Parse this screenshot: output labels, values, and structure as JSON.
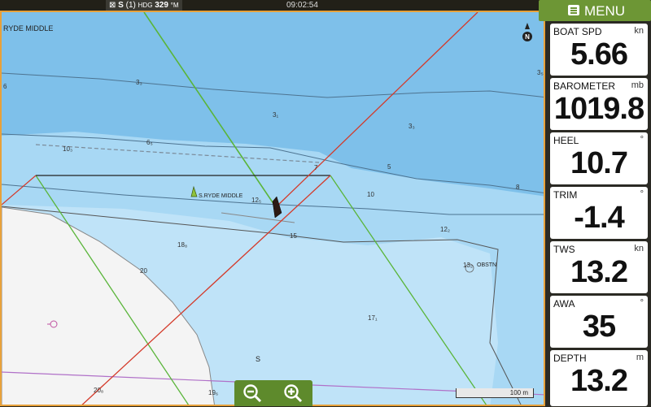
{
  "status": {
    "sat": "S",
    "sat_count": "(1)",
    "hdg_label": "HDG",
    "hdg_value": "329",
    "hdg_unit": "°M",
    "time": "09:02:54"
  },
  "menu": {
    "label": "MENU"
  },
  "chart": {
    "location_label": "RYDE MIDDLE",
    "buoy_label": "S.RYDE MIDDLE",
    "obstn_label": "OBSTN",
    "north_label": "N",
    "scale_label": "100 m",
    "seabed_label": "S",
    "depths": {
      "d1": "3₃",
      "d2": "3₁",
      "d3": "3₃",
      "d4": "6₅",
      "d5": "10₃",
      "d6": "7",
      "d7": "5",
      "d8": "10",
      "d9": "8",
      "d10": "12₅",
      "d11": "15",
      "d12": "12₂",
      "d13": "18₈",
      "d14": "13₂",
      "d15": "20",
      "d16": "17₁",
      "d17": "20₈",
      "d18": "19₆",
      "d19": "3₅",
      "d20": "6"
    }
  },
  "instruments": [
    {
      "label": "BOAT SPD",
      "unit": "kn",
      "value": "5.66"
    },
    {
      "label": "BAROMETER",
      "unit": "mb",
      "value": "1019.8"
    },
    {
      "label": "HEEL",
      "unit": "°",
      "value": "10.7"
    },
    {
      "label": "TRIM",
      "unit": "°",
      "value": "-1.4"
    },
    {
      "label": "TWS",
      "unit": "kn",
      "value": "13.2"
    },
    {
      "label": "AWA",
      "unit": "°",
      "value": "35"
    },
    {
      "label": "DEPTH",
      "unit": "m",
      "value": "13.2"
    }
  ],
  "colors": {
    "accent": "#6d9635",
    "chart_border": "#e8a13a",
    "deep_water": "#7ec0ea",
    "shallow_water": "#a8d8f4",
    "land": "#f4f4f4",
    "course_line": "#d43a2a",
    "laylines": "#5ab53a"
  }
}
